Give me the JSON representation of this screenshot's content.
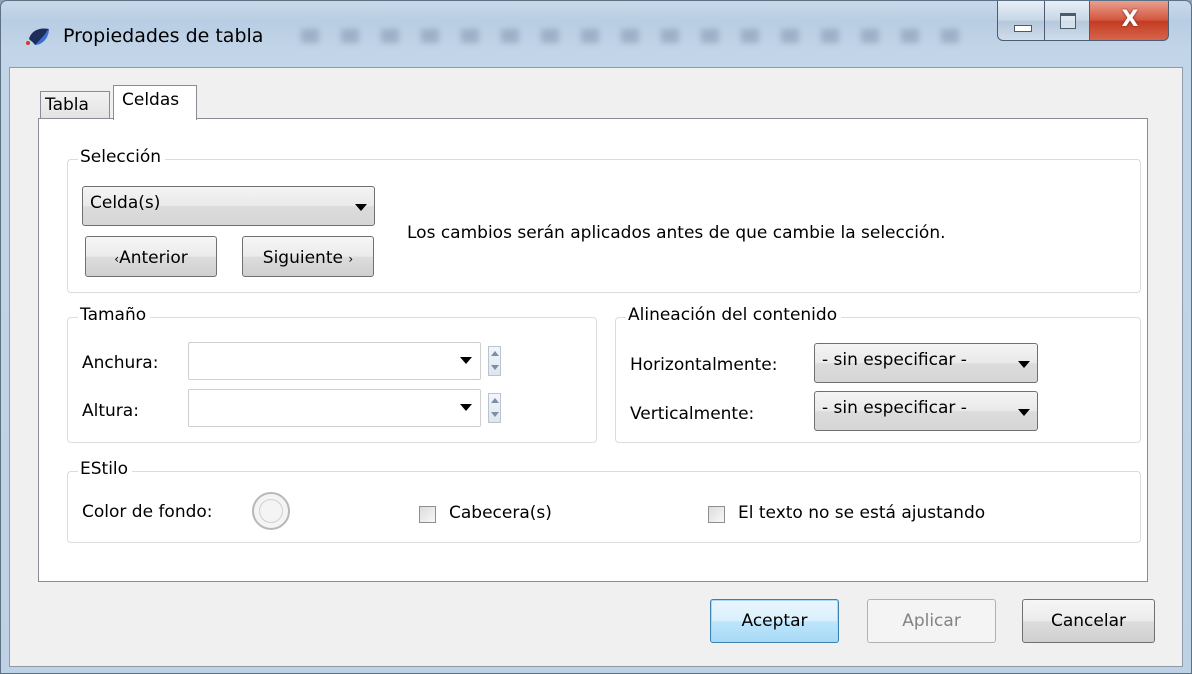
{
  "window": {
    "title": "Propiedades de tabla",
    "app_icon": "app-logo-icon",
    "controls": {
      "minimize_icon": "minimize-icon",
      "maximize_icon": "maximize-icon",
      "close_glyph": "X"
    }
  },
  "tabs": [
    {
      "label": "Tabla",
      "selected": false
    },
    {
      "label": "Celdas",
      "selected": true
    }
  ],
  "seleccion": {
    "legend": "Selección",
    "combo_value": "Celda(s)",
    "prev_label": "Anterior",
    "next_label": "Siguiente",
    "info_text": "Los cambios serán aplicados antes de que cambie la selección."
  },
  "tamano": {
    "legend": "Tamaño",
    "anchura_label": "Anchura:",
    "anchura_value": "",
    "altura_label": "Altura:",
    "altura_value": ""
  },
  "alineacion": {
    "legend": "Alineación del contenido",
    "horizontal_label": "Horizontalmente:",
    "horizontal_value": "- sin especificar -",
    "vertical_label": "Verticalmente:",
    "vertical_value": "- sin especificar -"
  },
  "estilo": {
    "legend": "EStilo",
    "color_label": "Color de fondo:",
    "cabecera_label": "Cabecera(s)",
    "cabecera_checked": false,
    "wrap_label": "El texto no se está ajustando",
    "wrap_checked": false
  },
  "buttons": {
    "aceptar": "Aceptar",
    "aplicar": "Aplicar",
    "aplicar_enabled": false,
    "cancelar": "Cancelar"
  },
  "colors": {
    "titlebar": "#c3d5e8",
    "close_button": "#c94a33",
    "default_button_border": "#3c7fb1",
    "disabled_text": "#838383"
  }
}
